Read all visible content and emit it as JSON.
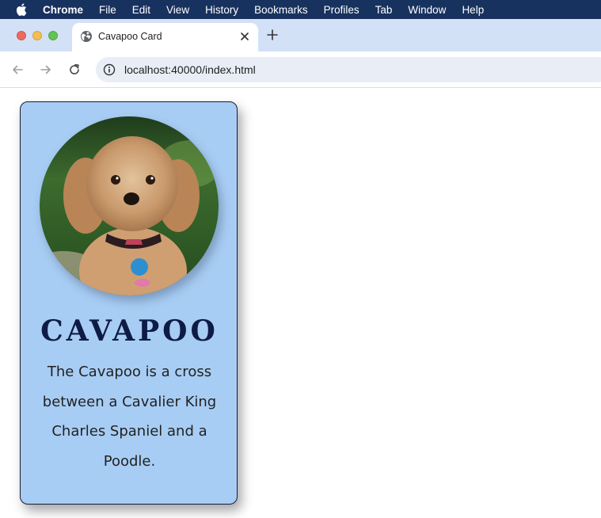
{
  "menubar": {
    "items": [
      "Chrome",
      "File",
      "Edit",
      "View",
      "History",
      "Bookmarks",
      "Profiles",
      "Tab",
      "Window",
      "Help"
    ]
  },
  "browser": {
    "tab_title": "Cavapoo Card",
    "url": "localhost:40000/index.html"
  },
  "card": {
    "title": "CAVAPOO",
    "text": "The Cavapoo is a cross between a Cavalier King Charles Spaniel and a Poodle."
  }
}
